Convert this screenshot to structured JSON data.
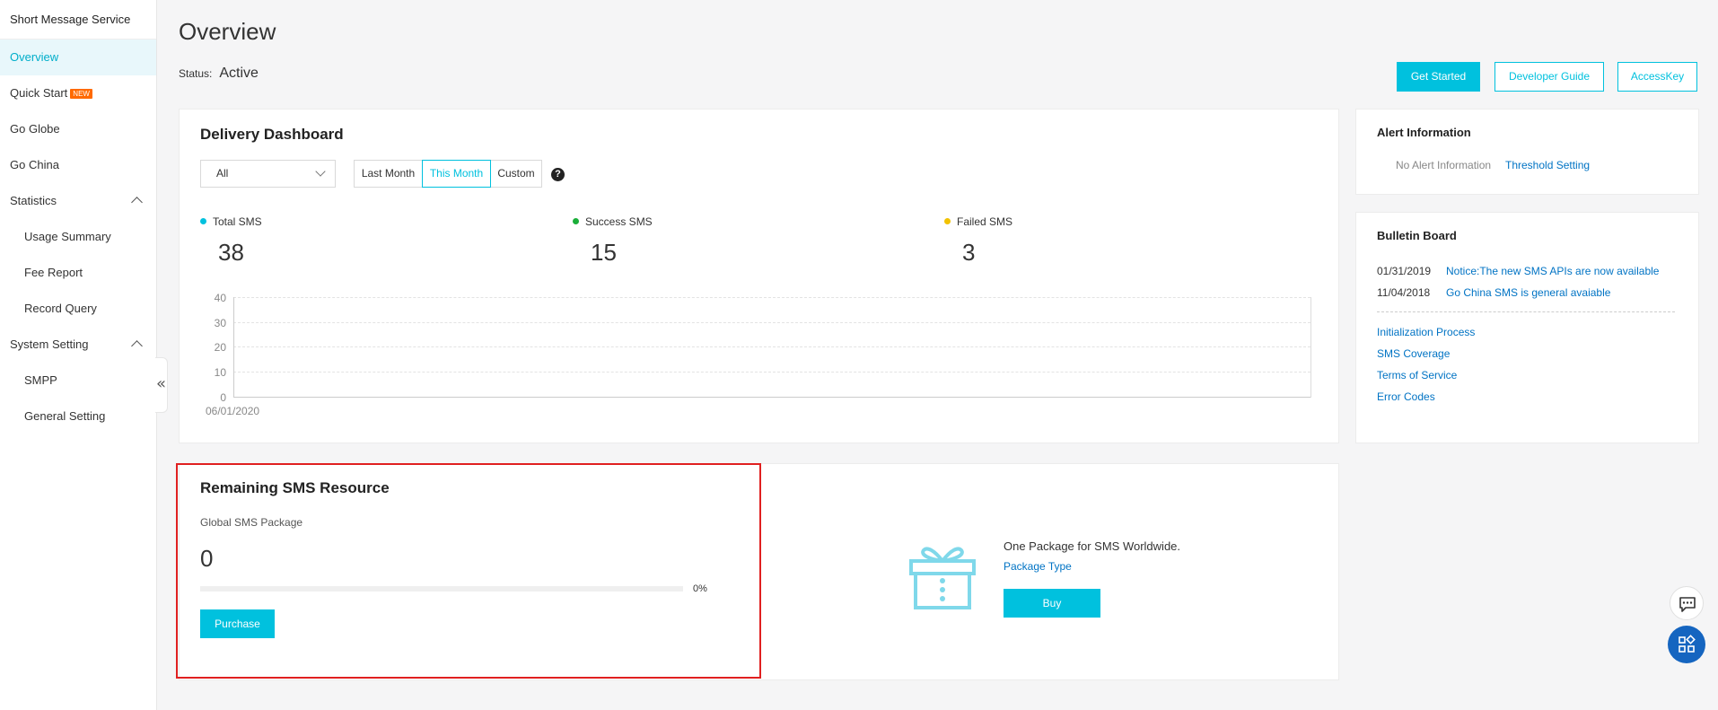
{
  "sidebar": {
    "title": "Short Message Service",
    "items": [
      {
        "label": "Overview"
      },
      {
        "label": "Quick Start",
        "badge": "NEW"
      },
      {
        "label": "Go Globe"
      },
      {
        "label": "Go China"
      },
      {
        "label": "Statistics"
      },
      {
        "label": "Usage Summary"
      },
      {
        "label": "Fee Report"
      },
      {
        "label": "Record Query"
      },
      {
        "label": "System Setting"
      },
      {
        "label": "SMPP"
      },
      {
        "label": "General Setting"
      }
    ],
    "collapse_glyph": "«"
  },
  "header": {
    "title": "Overview",
    "status_label": "Status:",
    "status_value": "Active",
    "buttons": {
      "get_started": "Get Started",
      "developer_guide": "Developer Guide",
      "access_key": "AccessKey"
    }
  },
  "dashboard": {
    "title": "Delivery Dashboard",
    "filter_value": "All",
    "ranges": [
      "Last Month",
      "This Month",
      "Custom"
    ],
    "selected_range": "This Month",
    "help_glyph": "?",
    "metrics": [
      {
        "label": "Total SMS",
        "value": "38",
        "color": "#00c1de"
      },
      {
        "label": "Success SMS",
        "value": "15",
        "color": "#1aae39"
      },
      {
        "label": "Failed SMS",
        "value": "3",
        "color": "#f2c200"
      }
    ]
  },
  "chart_data": {
    "type": "line",
    "x": [
      "06/01/2020"
    ],
    "series": [],
    "yticks": [
      "40",
      "30",
      "20",
      "10",
      "0"
    ],
    "ylim": [
      0,
      40
    ],
    "grid": true
  },
  "remaining": {
    "title": "Remaining SMS Resource",
    "package_label": "Global SMS Package",
    "value": "0",
    "percent_text": "0%",
    "percent": 0,
    "purchase_label": "Purchase"
  },
  "promo": {
    "headline": "One Package for SMS Worldwide.",
    "link": "Package Type",
    "buy_label": "Buy",
    "icon": "gift-icon"
  },
  "alert": {
    "title": "Alert Information",
    "empty_text": "No Alert Information",
    "threshold_link": "Threshold Setting"
  },
  "bulletin": {
    "title": "Bulletin Board",
    "notices": [
      {
        "date": "01/31/2019",
        "text": "Notice:The new SMS APIs are now available"
      },
      {
        "date": "11/04/2018",
        "text": "Go China SMS is general avaiable"
      }
    ],
    "links": [
      "Initialization Process",
      "SMS Coverage",
      "Terms of Service",
      "Error Codes"
    ]
  },
  "floating": {
    "chat_icon": "chat-icon",
    "apps_icon": "apps-icon"
  }
}
